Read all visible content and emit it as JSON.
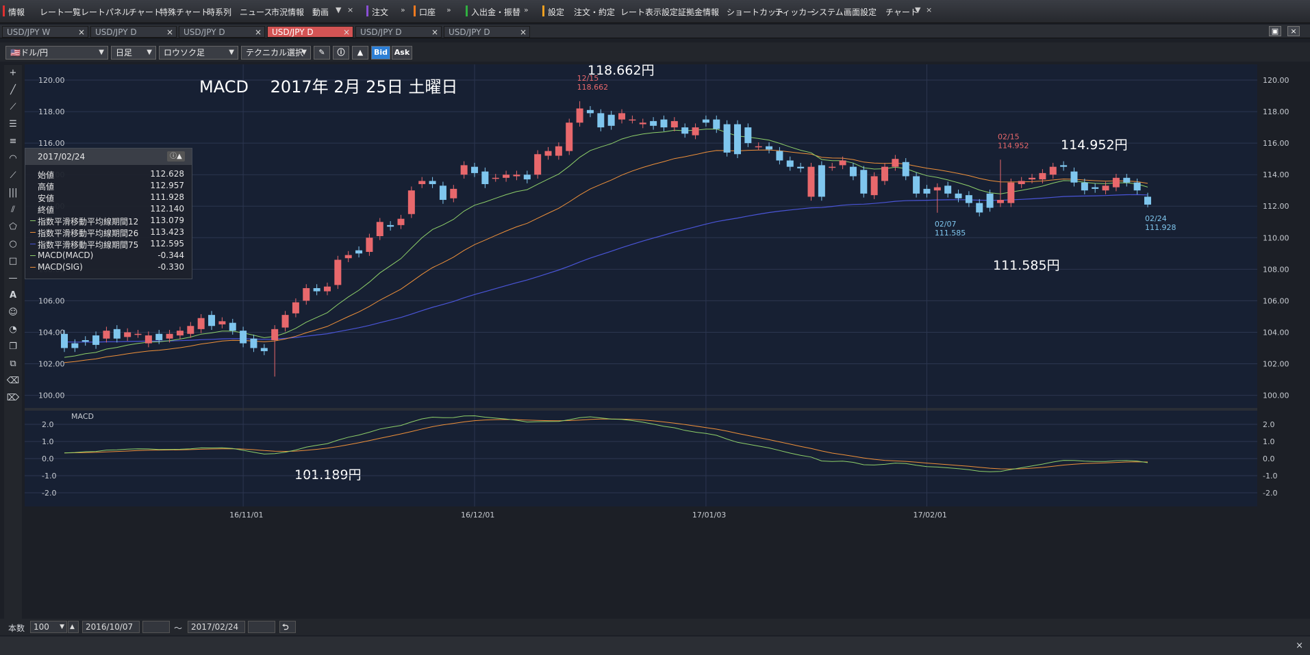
{
  "menubar": {
    "items": [
      "情報",
      "レート一覧",
      "レートパネル",
      "チャート",
      "特殊チャート",
      "時系列",
      "ニュース",
      "市況情報",
      "動画",
      "注文",
      "口座",
      "入出金・振替",
      "設定",
      "注文・約定",
      "レート表示設定",
      "証拠金情報",
      "ショートカット",
      "ティッカー",
      "システム",
      "画面設定",
      "チャート"
    ],
    "close": "×"
  },
  "tabs": [
    "USD/JPY W",
    "USD/JPY D",
    "USD/JPY D",
    "USD/JPY D",
    "USD/JPY D",
    "USD/JPY D"
  ],
  "tab_close": "×",
  "toolbar": {
    "pair": "ドル/円",
    "timeframe": "日足",
    "chart_type": "ロウソク足",
    "technical": "テクニカル選択",
    "bid": "Bid",
    "ask": "Ask"
  },
  "info_panel": {
    "date": "2017/02/24",
    "rows": [
      {
        "label": "始値",
        "value": "112.628"
      },
      {
        "label": "高値",
        "value": "112.957"
      },
      {
        "label": "安値",
        "value": "111.928"
      },
      {
        "label": "終値",
        "value": "112.140"
      },
      {
        "label": "指数平滑移動平均線期間12",
        "value": "113.079",
        "color": "#8fd16a"
      },
      {
        "label": "指数平滑移動平均線期間26",
        "value": "113.423",
        "color": "#f0913a"
      },
      {
        "label": "指数平滑移動平均線期間75",
        "value": "112.595",
        "color": "#4a55d8"
      },
      {
        "label": "MACD(MACD)",
        "value": "-0.344",
        "color": "#8fd16a"
      },
      {
        "label": "MACD(SIG)",
        "value": "-0.330",
        "color": "#f0913a"
      }
    ]
  },
  "chart_data": {
    "type": "candlestick",
    "title": "MACD　 2017年 2月 25日 土曜日",
    "symbol": "USD/JPY",
    "ylim": [
      99.2,
      121.0
    ],
    "yticks": [
      "120.00",
      "118.00",
      "116.00",
      "114.00",
      "112.00",
      "110.00",
      "108.00",
      "106.00",
      "104.00",
      "102.00",
      "100.00"
    ],
    "xticks": [
      {
        "label": "16/11/01",
        "index": 17
      },
      {
        "label": "16/12/01",
        "index": 39
      },
      {
        "label": "17/01/03",
        "index": 61
      },
      {
        "label": "17/02/01",
        "index": 82
      }
    ],
    "candles": [
      [
        103.9,
        103.0
      ],
      [
        103.3,
        103.0
      ],
      [
        103.5,
        103.4
      ],
      [
        103.8,
        103.2
      ],
      [
        103.6,
        104.1
      ],
      [
        104.2,
        103.6
      ],
      [
        103.7,
        104.0
      ],
      [
        103.9,
        103.9
      ],
      [
        103.3,
        103.8
      ],
      [
        103.9,
        103.5
      ],
      [
        103.6,
        103.9
      ],
      [
        103.8,
        104.1
      ],
      [
        103.9,
        104.4
      ],
      [
        104.2,
        104.9
      ],
      [
        105.1,
        104.4
      ],
      [
        104.5,
        104.7
      ],
      [
        104.6,
        104.1
      ],
      [
        104.1,
        103.3
      ],
      [
        103.6,
        103.0
      ],
      [
        103.0,
        102.8
      ],
      [
        103.5,
        104.2
      ],
      [
        104.3,
        105.1
      ],
      [
        105.2,
        105.9
      ],
      [
        106.0,
        106.8
      ],
      [
        106.8,
        106.6
      ],
      [
        106.6,
        106.9
      ],
      [
        107.0,
        108.6
      ],
      [
        108.7,
        108.9
      ],
      [
        109.2,
        109.0
      ],
      [
        109.1,
        110.0
      ],
      [
        110.1,
        111.0
      ],
      [
        110.8,
        110.7
      ],
      [
        110.8,
        111.2
      ],
      [
        111.5,
        113.0
      ],
      [
        113.4,
        113.6
      ],
      [
        113.6,
        113.4
      ],
      [
        113.3,
        112.4
      ],
      [
        112.5,
        113.1
      ],
      [
        114.0,
        114.6
      ],
      [
        114.5,
        114.1
      ],
      [
        114.2,
        113.4
      ],
      [
        113.8,
        113.8
      ],
      [
        113.8,
        114.0
      ],
      [
        113.9,
        114.0
      ],
      [
        114.0,
        113.7
      ],
      [
        114.0,
        115.3
      ],
      [
        115.2,
        115.5
      ],
      [
        115.2,
        115.8
      ],
      [
        115.5,
        117.3
      ],
      [
        117.3,
        118.2
      ],
      [
        118.1,
        117.9
      ],
      [
        117.9,
        117.0
      ],
      [
        117.8,
        117.1
      ],
      [
        117.5,
        117.9
      ],
      [
        117.5,
        117.5
      ],
      [
        117.2,
        117.3
      ],
      [
        117.4,
        117.1
      ],
      [
        117.5,
        117.0
      ],
      [
        117.0,
        117.4
      ],
      [
        117.0,
        116.6
      ],
      [
        116.5,
        117.0
      ],
      [
        117.5,
        117.3
      ],
      [
        117.5,
        116.9
      ],
      [
        117.2,
        115.4
      ],
      [
        117.2,
        115.3
      ],
      [
        117.0,
        116.0
      ],
      [
        115.8,
        115.8
      ],
      [
        115.8,
        115.6
      ],
      [
        115.5,
        114.9
      ],
      [
        114.9,
        114.5
      ],
      [
        114.5,
        114.4
      ],
      [
        112.6,
        114.5
      ],
      [
        114.6,
        112.6
      ],
      [
        114.5,
        114.5
      ],
      [
        114.6,
        114.9
      ],
      [
        114.5,
        113.9
      ],
      [
        114.3,
        112.8
      ],
      [
        112.7,
        113.9
      ],
      [
        113.6,
        114.5
      ],
      [
        114.5,
        115.0
      ],
      [
        114.8,
        113.9
      ],
      [
        113.9,
        112.8
      ],
      [
        113.1,
        112.8
      ],
      [
        113.0,
        113.2
      ],
      [
        113.3,
        112.8
      ],
      [
        112.8,
        112.5
      ],
      [
        112.7,
        112.2
      ],
      [
        112.2,
        111.6
      ],
      [
        112.8,
        111.9
      ],
      [
        112.2,
        112.4
      ],
      [
        112.2,
        113.5
      ],
      [
        113.4,
        113.6
      ],
      [
        113.7,
        113.8
      ],
      [
        113.7,
        114.1
      ],
      [
        114.0,
        114.5
      ],
      [
        114.6,
        114.5
      ],
      [
        114.2,
        113.5
      ],
      [
        113.5,
        113.0
      ],
      [
        113.2,
        113.1
      ],
      [
        113.0,
        113.3
      ],
      [
        113.2,
        113.8
      ],
      [
        113.8,
        113.5
      ],
      [
        113.5,
        113.0
      ],
      [
        112.6,
        112.1
      ]
    ],
    "annotations": [
      {
        "text": "118.662円",
        "index": 49,
        "value": 118.662
      },
      {
        "text": "101.189円",
        "index": 20,
        "value": 101.189
      },
      {
        "text": "114.952円",
        "index": 89,
        "value": 114.952
      },
      {
        "text": "111.585円",
        "index": 83,
        "value": 111.585
      }
    ],
    "markers": [
      {
        "date": "12/15",
        "value": "118.662",
        "index": 49,
        "kind": "high"
      },
      {
        "date": "02/15",
        "value": "114.952",
        "index": 89,
        "kind": "high"
      },
      {
        "date": "02/07",
        "value": "111.585",
        "index": 83,
        "kind": "low"
      },
      {
        "date": "02/24",
        "value": "111.928",
        "index": 103,
        "kind": "low"
      }
    ],
    "macd": {
      "label": "MACD",
      "ylim": [
        -2.8,
        2.8
      ],
      "yticks": [
        "2.0",
        "1.0",
        "0.0",
        "-1.0",
        "-2.0"
      ]
    }
  },
  "bottom": {
    "count_label": "本数",
    "count": "100",
    "from_date": "2016/10/07",
    "tilde": "〜",
    "to_date": "2017/02/24"
  },
  "status": {
    "close": "×"
  }
}
